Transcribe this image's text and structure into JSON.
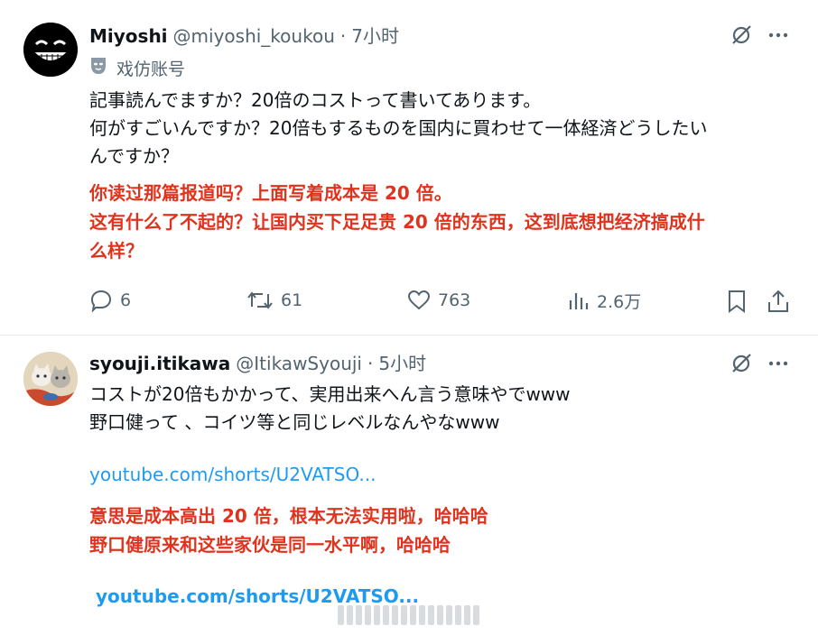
{
  "posts": [
    {
      "display_name": "Miyoshi",
      "handle": "@miyoshi_koukou",
      "dot": "·",
      "time": "7小时",
      "parody_label": "戏仿账号",
      "text_lines": [
        "記事読んでますか？20倍のコストって書いてあります。",
        "何がすごいんですか？20倍もするものを国内に買わせて一体経済どうしたい",
        "んですか？"
      ],
      "translation_lines": [
        "你读过那篇报道吗？上面写着成本是 20 倍。",
        "这有什么了不起的？让国内买下足足贵 20 倍的东西，这到底想把经济搞成什",
        "么样？"
      ],
      "actions": {
        "reply_count": "6",
        "retweet_count": "61",
        "like_count": "763",
        "view_count": "2.6万"
      }
    },
    {
      "display_name": "syouji.itikawa",
      "handle": "@ItikawSyouji",
      "dot": "·",
      "time": "5小时",
      "text_lines": [
        "コストが20倍もかかって、実用出来へん言う意味やでwww",
        "野口健って 、コイツ等と同じレベルなんやなwww"
      ],
      "link": "youtube.com/shorts/U2VATSO...",
      "translation_lines": [
        "意思是成本高出 20 倍，根本无法实用啦，哈哈哈",
        "野口健原来和这些家伙是同一水平啊，哈哈哈"
      ],
      "translation_link": "youtube.com/shorts/U2VATSO..."
    }
  ],
  "colors": {
    "text_primary": "#0f1419",
    "text_secondary": "#536471",
    "link": "#1d9bf0",
    "translation_red": "#e0331d"
  },
  "icons": {
    "grok": "grok-icon",
    "more": "more-icon",
    "parody_mask": "mask-icon",
    "reply": "reply-icon",
    "retweet": "retweet-icon",
    "like": "heart-icon",
    "views": "views-icon",
    "bookmark": "bookmark-icon",
    "share": "share-icon"
  }
}
